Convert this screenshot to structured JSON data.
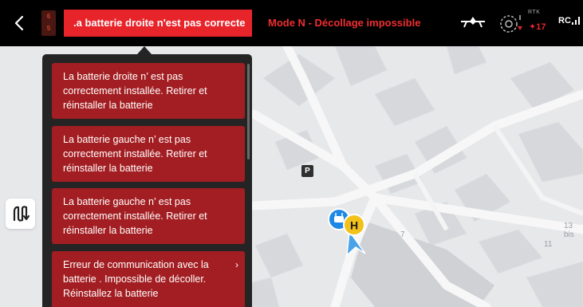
{
  "colors": {
    "alert_red": "#e8242b",
    "card_red": "#a31e22",
    "popup_bg": "#242424",
    "map_bg": "#e7e8ea",
    "home_yellow": "#f2c21b",
    "drone_blue": "#1e88e5"
  },
  "topbar": {
    "back_icon": "chevron-left-icon",
    "battery_top": "6",
    "battery_bottom": "5",
    "alert_banner_text": ".a batterie droite n'est pas correcte",
    "mode_status": "Mode N - Décollage impossible",
    "aircraft_icon": "aircraft-icon",
    "gps_icon": "gps-icon",
    "rtk_label": "RTK",
    "satellite_count": "17",
    "rc_label": "RC"
  },
  "alerts": [
    {
      "text": "La batterie droite n’ est pas correctement installée. Retirer et réinstaller la batterie",
      "has_chevron": false
    },
    {
      "text": "La batterie gauche n’ est pas correctement installée. Retirer et réinstaller la batterie",
      "has_chevron": false
    },
    {
      "text": "La batterie gauche n’ est pas correctement installée. Retirer et réinstaller la batterie",
      "has_chevron": false
    },
    {
      "text": "Erreur de communication avec la batterie . Impossible de décoller. Réinstallez la batterie",
      "has_chevron": true,
      "chevron": "›"
    }
  ],
  "map": {
    "labels": {
      "house_13bis": "13 bis",
      "house_11": "11",
      "house_7": "7"
    },
    "parking_label": "P",
    "home_label": "H",
    "route_tool_icon": "route-icon"
  }
}
